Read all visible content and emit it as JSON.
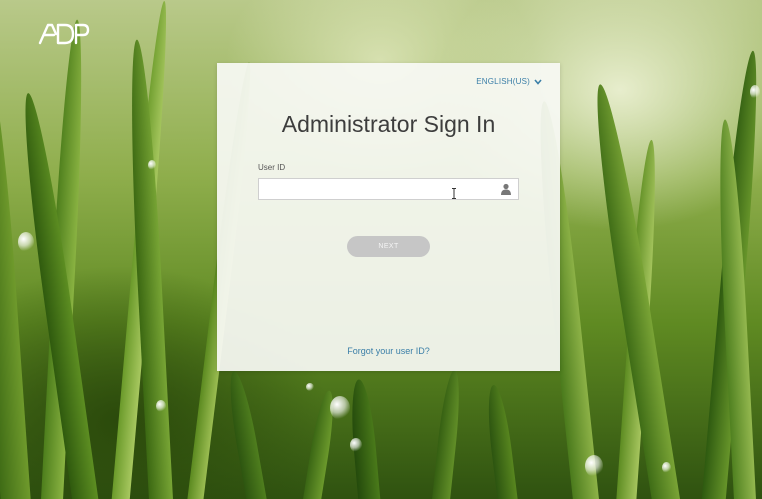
{
  "logo": {
    "text": "ADP"
  },
  "language": {
    "label": "ENGLISH(US)",
    "icon": "chevron-down-icon"
  },
  "signin": {
    "title": "Administrator Sign In",
    "user_id_label": "User ID",
    "user_id_value": "",
    "user_icon": "user-icon",
    "next_label": "NEXT",
    "forgot_link": "Forgot your user ID?"
  },
  "colors": {
    "link": "#3b7fa8",
    "button_disabled": "#c6c6c6",
    "card_bg": "#f8f9f4"
  }
}
